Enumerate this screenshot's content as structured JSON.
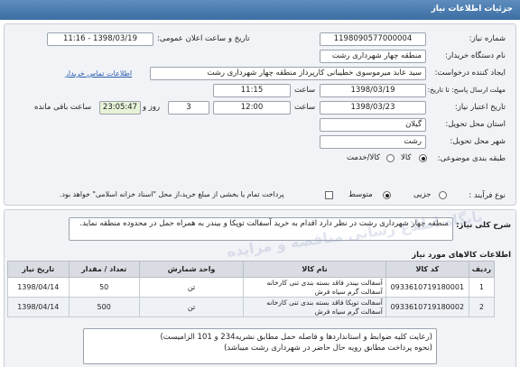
{
  "header": {
    "title": "جزئیات اطلاعات نیاز"
  },
  "fields": {
    "need_number_label": "شماره نیاز:",
    "need_number": "1198090577000004",
    "announce_label": "تاریخ و ساعت اعلان عمومی:",
    "announce_value": "1398/03/19 - 11:16",
    "buyer_label": "نام دستگاه خریدار:",
    "buyer_value": "منطقه چهار شهرداری رشت",
    "creator_label": "ایجاد کننده درخواست:",
    "creator_value": "سید عابد میرموسوی خطیبانی کارپرداز منطقه چهار شهرداری رشت",
    "contact_link": "اطلاعات تماس خریدار",
    "send_deadline_label": "مهلت ارسال پاسخ: تا تاریخ:",
    "send_date": "1398/03/19",
    "time_label": "ساعت",
    "send_time": "11:15",
    "validity_label": "تاریخ اعتبار نیاز:",
    "validity_date": "1398/03/23",
    "validity_time": "12:00",
    "days_value": "3",
    "days_label": "روز و",
    "remaining_time": "23:05:47",
    "remaining_label": "ساعت باقی مانده",
    "province_label": "استان محل تحویل:",
    "province_value": "گیلان",
    "city_label": "شهر محل تحویل:",
    "city_value": "رشت",
    "category_label": "طبقه بندی موضوعی:",
    "category_options": [
      "کالا",
      "کالا/خدمت"
    ],
    "process_label": "نوع فرآیند :",
    "process_options": [
      "جزیی",
      "متوسط"
    ],
    "payment_text": "پرداخت تمام یا بخشی از مبلغ خرید،از محل \"اسناد خزانه اسلامی\" خواهد بود."
  },
  "description": {
    "label": "شرح کلی نیاز:",
    "text": "منطقه چهار شهرداری رشت در نظر دارد اقدام به خرید آسفالت توپکا و بیندر به همراه حمل در محدوده منطقه نماید."
  },
  "goods": {
    "label": "اطلاعات کالاهای مورد نیاز",
    "columns": [
      "ردیف",
      "کد کالا",
      "نام کالا",
      "واحد شمارش",
      "تعداد / مقدار",
      "تاریخ نیاز"
    ],
    "rows": [
      {
        "row": "1",
        "code": "0933610719180001",
        "name": "آسفالت بیندر فاقد بسته بندی تنی کارخانه آسفالت گرم سیاه فرش",
        "unit": "تن",
        "qty": "50",
        "date": "1398/04/14"
      },
      {
        "row": "2",
        "code": "0933610719180002",
        "name": "آسفالت توپکا فاقد بسته بندی تنی کارخانه آسفالت گرم سیاه فرش",
        "unit": "تن",
        "qty": "500",
        "date": "1398/04/14"
      }
    ]
  },
  "notes": {
    "line1": "(رعایت کلیه ضوابط و استانداردها و فاصله حمل مطابق نشریه234 و 101 الزامیست)",
    "line2": "(نحوه پرداخت مطابق رویه حال حاضر در شهرداری رشت میباشد)"
  },
  "watermark": "پایگاه اطلاع رسانی مناقصه و مزایده"
}
